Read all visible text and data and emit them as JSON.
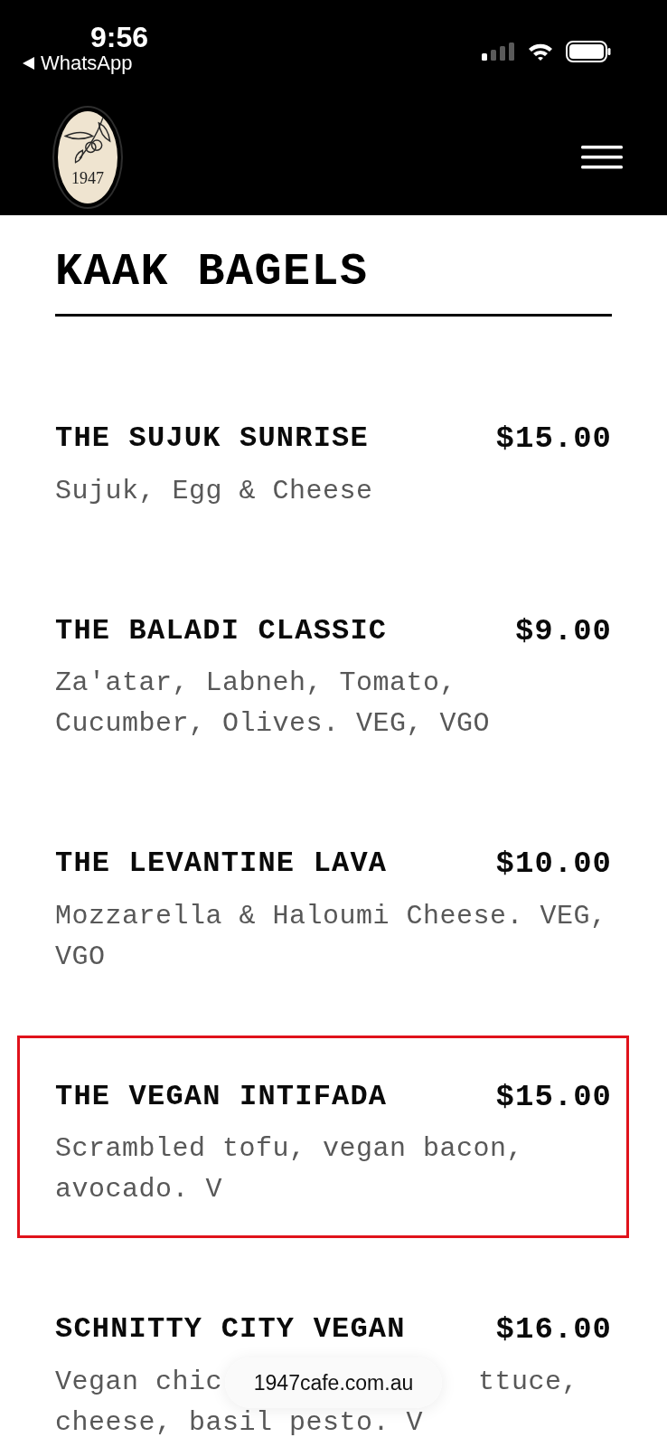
{
  "status_bar": {
    "time": "9:56",
    "back_label": "WhatsApp"
  },
  "header": {
    "logo_text": "1947"
  },
  "section": {
    "title": "KAAK BAGELS",
    "items": [
      {
        "name": "THE SUJUK SUNRISE",
        "price": "$15.00",
        "description": "Sujuk, Egg & Cheese",
        "highlighted": false
      },
      {
        "name": "THE BALADI CLASSIC",
        "price": "$9.00",
        "description": "Za'atar, Labneh, Tomato, Cucumber, Olives. VEG, VGO",
        "highlighted": false
      },
      {
        "name": "THE LEVANTINE LAVA",
        "price": "$10.00",
        "description": "Mozzarella & Haloumi Cheese. VEG, VGO",
        "highlighted": false
      },
      {
        "name": "THE VEGAN INTIFADA",
        "price": "$15.00",
        "description": "Scrambled tofu, vegan bacon, avocado. V",
        "highlighted": true
      },
      {
        "name": "SCHNITTY CITY VEGAN",
        "price": "$16.00",
        "description_lines": [
          [
            "Vegan chic",
            "ttuce,"
          ],
          [
            "cheese, basil pesto. V"
          ]
        ],
        "highlighted": false
      }
    ]
  },
  "address_bar": {
    "url": "1947cafe.com.au"
  }
}
